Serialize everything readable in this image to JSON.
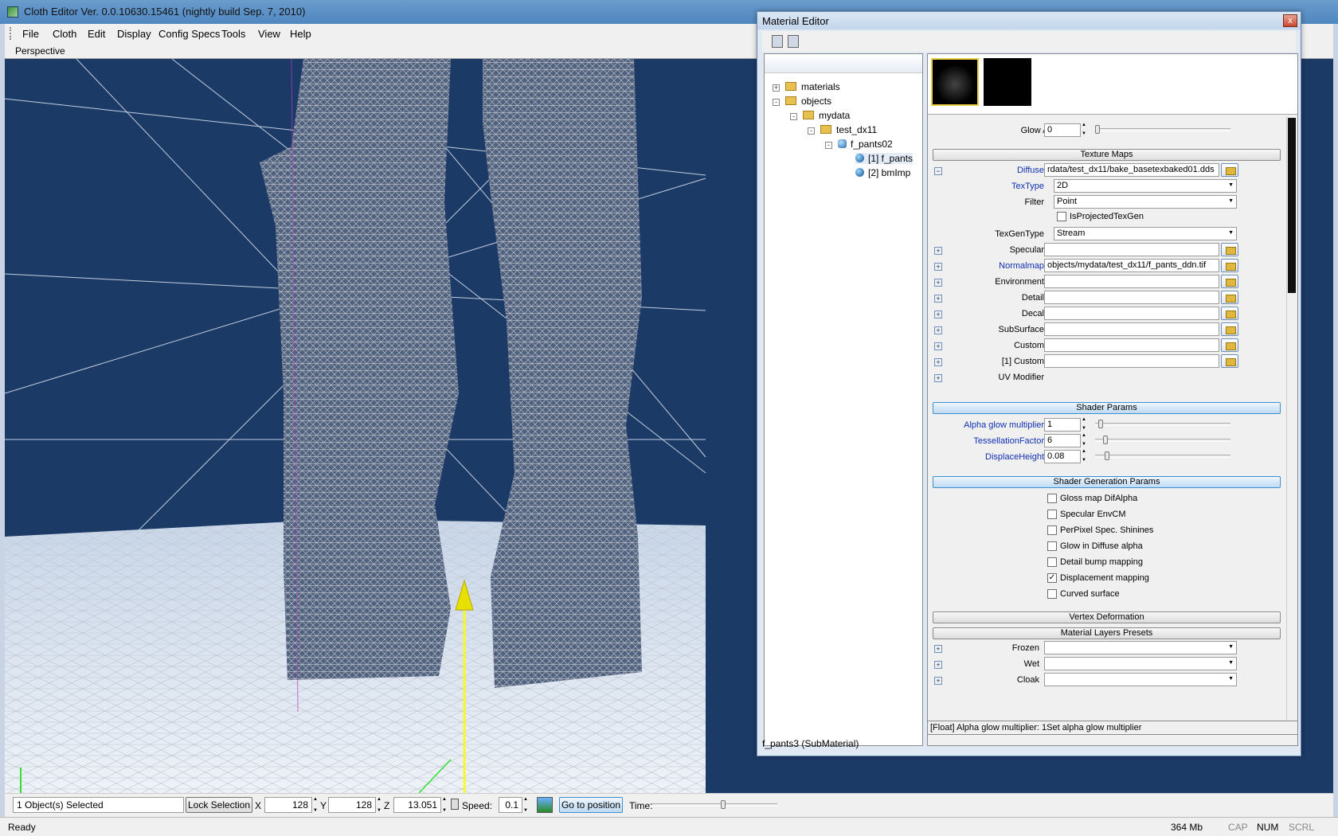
{
  "window": {
    "title": "Cloth Editor Ver. 0.0.10630.15461 (nightly build Sep. 7, 2010)"
  },
  "menu": [
    "File",
    "Cloth",
    "Edit",
    "Display",
    "Config Specs",
    "Tools",
    "View",
    "Help"
  ],
  "viewport": {
    "label": "Perspective"
  },
  "status": {
    "selection": "1 Object(s) Selected",
    "lock_button": "Lock Selection",
    "x_label": "X",
    "x_value": "128",
    "y_label": "Y",
    "y_value": "128",
    "z_label": "Z",
    "z_value": "13.051",
    "speed_label": "Speed:",
    "speed_value": "0.1",
    "goto_button": "Go to position",
    "time_label": "Time:",
    "time_position": 0.58
  },
  "bottom": {
    "ready": "Ready",
    "memory": "364 Mb",
    "cap": "CAP",
    "num": "NUM",
    "scrl": "SCRL"
  },
  "material_editor": {
    "title": "Material Editor",
    "close": "x",
    "tree": [
      {
        "label": "materials",
        "kind": "folder",
        "expander": "+"
      },
      {
        "label": "objects",
        "kind": "folder",
        "expander": "-"
      },
      {
        "label": "mydata",
        "kind": "folder",
        "expander": "-"
      },
      {
        "label": "test_dx11",
        "kind": "folder",
        "expander": "-"
      },
      {
        "label": "f_pants02",
        "kind": "object",
        "expander": "-"
      },
      {
        "label": "[1] f_pants",
        "kind": "submaterial"
      },
      {
        "label": "[2] bmImp",
        "kind": "submaterial"
      }
    ],
    "glow_amount": {
      "label": "Glow Amount",
      "value": "0"
    },
    "texture_maps": {
      "header": "Texture Maps",
      "diffuse": {
        "label": "Diffuse",
        "value": "rdata/test_dx11/bake_basetexbaked01.dds"
      },
      "textype": {
        "label": "TexType",
        "value": "2D"
      },
      "filter": {
        "label": "Filter",
        "value": "Point"
      },
      "isprojected": {
        "label": "IsProjectedTexGen",
        "checked": false
      },
      "texgentype": {
        "label": "TexGenType",
        "value": "Stream"
      },
      "specular": {
        "label": "Specular",
        "value": ""
      },
      "normalmap": {
        "label": "Normalmap",
        "value": "objects/mydata/test_dx11/f_pants_ddn.tif"
      },
      "environment": {
        "label": "Environment",
        "value": ""
      },
      "detail": {
        "label": "Detail",
        "value": ""
      },
      "decal": {
        "label": "Decal",
        "value": ""
      },
      "subsurface": {
        "label": "SubSurface",
        "value": ""
      },
      "custom": {
        "label": "Custom",
        "value": ""
      },
      "custom1": {
        "label": "[1] Custom",
        "value": ""
      },
      "uvmod": {
        "label": "UV Modifier"
      }
    },
    "shader_params": {
      "header": "Shader Params",
      "alpha_glow": {
        "label": "Alpha glow multiplier",
        "value": "1"
      },
      "tess": {
        "label": "TessellationFactor",
        "value": "6"
      },
      "displace": {
        "label": "DisplaceHeight",
        "value": "0.08"
      }
    },
    "shader_gen": {
      "header": "Shader Generation Params",
      "items": [
        {
          "label": "Gloss map DifAlpha",
          "checked": false
        },
        {
          "label": "Specular EnvCM",
          "checked": false
        },
        {
          "label": "PerPixel Spec. Shinines",
          "checked": false
        },
        {
          "label": "Glow in Diffuse alpha",
          "checked": false
        },
        {
          "label": "Detail bump mapping",
          "checked": false
        },
        {
          "label": "Displacement mapping",
          "checked": true
        },
        {
          "label": "Curved surface",
          "checked": false
        }
      ]
    },
    "vertex_deformation": "Vertex Deformation",
    "layers": {
      "header": "Material Layers Presets",
      "frozen": {
        "label": "Frozen",
        "value": ""
      },
      "wet": {
        "label": "Wet",
        "value": ""
      },
      "cloak": {
        "label": "Cloak",
        "value": ""
      }
    },
    "status": "[Float] Alpha glow multiplier: 1Set alpha glow multiplier",
    "footer": "f_pants3 (SubMaterial)"
  },
  "colors": {
    "viewport_bg": "#1c3a66",
    "grid": "#dfe8f5",
    "gizmo": "#ffff00",
    "accent": "#3c8fd0"
  }
}
